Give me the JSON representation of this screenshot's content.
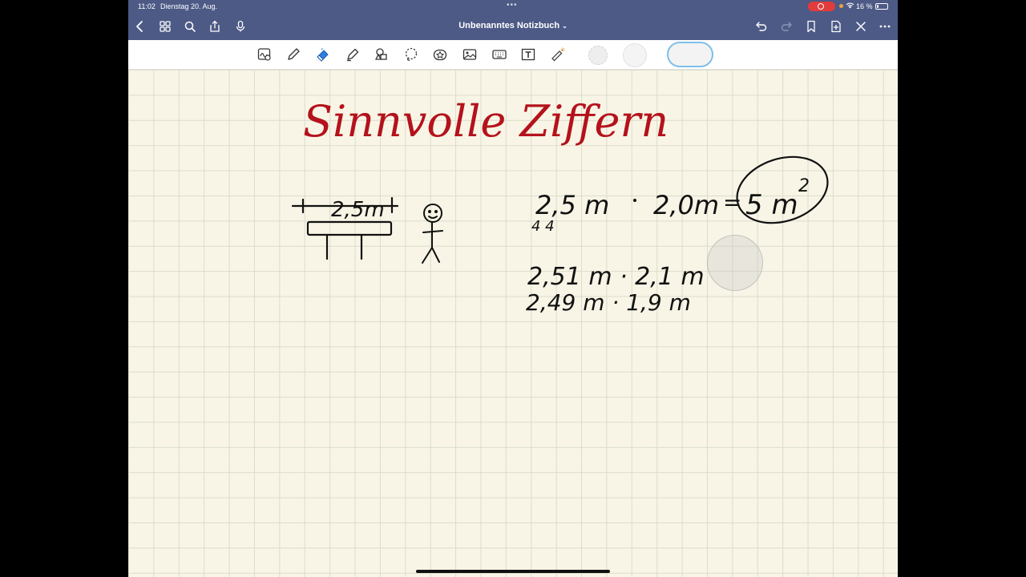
{
  "status": {
    "time": "11:02",
    "date": "Dienstag 20. Aug.",
    "battery": "16 %",
    "battery_level": 0.16
  },
  "nav": {
    "title": "Unbenanntes Notizbuch"
  },
  "notebook": {
    "title": "Sinnvolle Ziffern",
    "sketch_label": "2,5m",
    "line1_a": "2,5 m",
    "line1_b": "2,0m",
    "line1_eq": "=",
    "line1_result": "5 m",
    "line1_sup": "2",
    "line2": "2,51 m · 2,1 m",
    "line3": "2,49 m · 1,9 m"
  },
  "colors": {
    "nav_bg": "#4d5a86",
    "paper": "#f8f5e6",
    "grid": "#dcdccb",
    "ink_red": "#b4121c",
    "ink_black": "#111111",
    "record_red": "#e23b3b"
  }
}
